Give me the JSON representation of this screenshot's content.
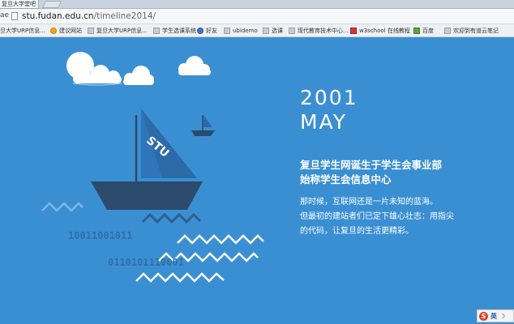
{
  "browser": {
    "tab_title": "复旦大学堂吧",
    "address_prefix": "ae",
    "url_host": "stu.fudan.edu.cn",
    "url_path": "/timeline2014/"
  },
  "bookmarks": [
    {
      "label": "旦大学URP信息...",
      "icon": "page-icon"
    },
    {
      "label": "建议网站",
      "icon": "orange-icon"
    },
    {
      "label": "复旦大学URP信息...",
      "icon": "page-icon"
    },
    {
      "label": "学生选课系统",
      "icon": "page-icon"
    },
    {
      "label": "好友",
      "icon": "blue-icon"
    },
    {
      "label": "ubidemo",
      "icon": "page-icon"
    },
    {
      "label": "选课",
      "icon": "page-icon"
    },
    {
      "label": "现代教育技术中心...",
      "icon": "page-icon"
    },
    {
      "label": "w3school 在线教程",
      "icon": "red-icon"
    },
    {
      "label": "百度",
      "icon": "green-icon"
    },
    {
      "label": "欢迎到有道云笔记",
      "icon": "page-icon"
    }
  ],
  "timeline": {
    "year": "2001",
    "month": "MAY",
    "headline_line1": "复旦学生网诞生于学生会事业部",
    "headline_line2": "始称学生会信息中心",
    "para_line1": "那时候，互联网还是一片未知的蓝海。",
    "para_line2": "但最初的建站者们已定下雄心壮志：用指尖",
    "para_line3": "的代码，让复旦的生活更精彩。"
  },
  "illustration": {
    "sail_label": "STU",
    "binary_line1": "10011001011",
    "binary_line2": "0110101110001"
  },
  "ime": {
    "logo": "S",
    "mode": "英"
  },
  "colors": {
    "background": "#3a8fd3",
    "boat_hull": "#2c4a6b",
    "sail": "#2c6aa8",
    "binary": "#2f6fa8",
    "wave_light": "#ffffff",
    "wave_dark": "#2e5f8d"
  }
}
